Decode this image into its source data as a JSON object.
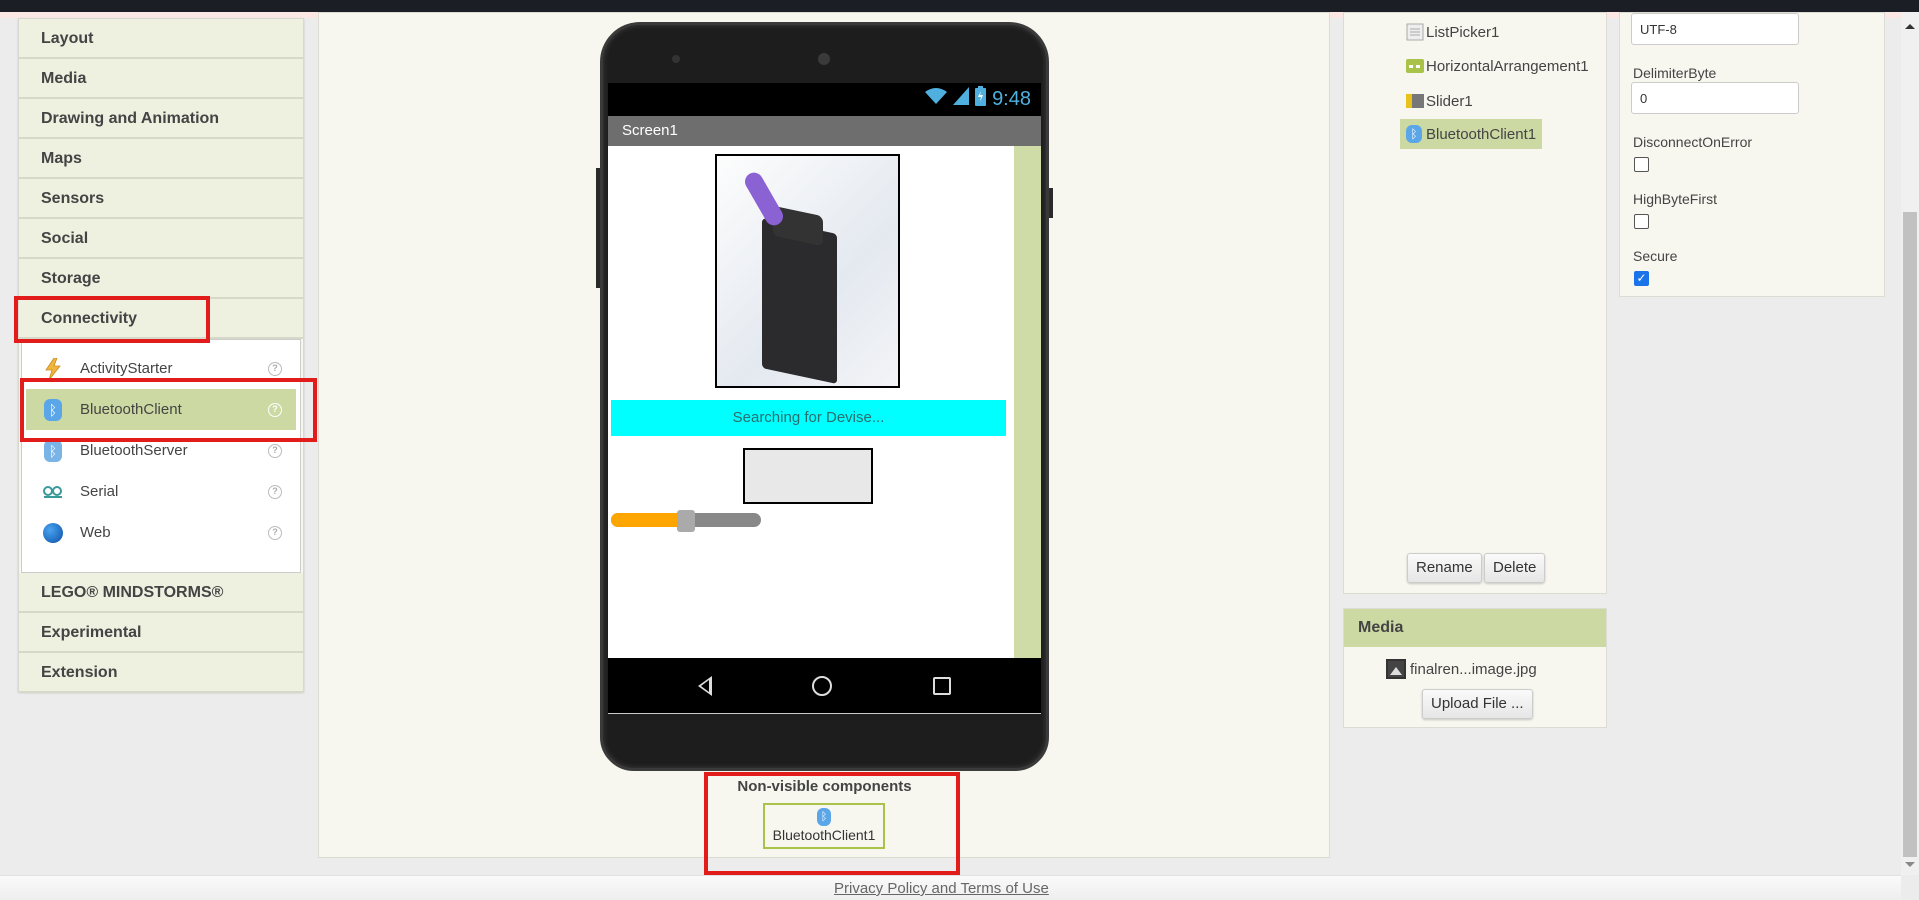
{
  "palette": {
    "categories_top": [
      "Layout",
      "Media",
      "Drawing and Animation",
      "Maps",
      "Sensors",
      "Social",
      "Storage",
      "Connectivity"
    ],
    "connectivity_items": [
      {
        "label": "ActivityStarter",
        "icon": "lightning-icon",
        "help": "?"
      },
      {
        "label": "BluetoothClient",
        "icon": "bluetooth-icon",
        "help": "?",
        "selected": true
      },
      {
        "label": "BluetoothServer",
        "icon": "bluetooth-icon",
        "help": "?"
      },
      {
        "label": "Serial",
        "icon": "serial-icon",
        "help": "?"
      },
      {
        "label": "Web",
        "icon": "globe-icon",
        "help": "?"
      }
    ],
    "categories_bottom": [
      "LEGO® MINDSTORMS®",
      "Experimental",
      "Extension"
    ]
  },
  "phone": {
    "status_time": "9:48",
    "screen_title": "Screen1",
    "label_text": "Searching for Devise...",
    "slider_value_fraction": 0.5
  },
  "nonvisible": {
    "title": "Non-visible components",
    "items": [
      "BluetoothClient1"
    ]
  },
  "components": {
    "items": [
      {
        "label": "ListPicker1",
        "icon": "listpicker-icon"
      },
      {
        "label": "HorizontalArrangement1",
        "icon": "horizontal-arrangement-icon"
      },
      {
        "label": "Slider1",
        "icon": "slider-icon"
      },
      {
        "label": "BluetoothClient1",
        "icon": "bluetooth-icon",
        "selected": true
      }
    ],
    "rename_label": "Rename",
    "delete_label": "Delete"
  },
  "media": {
    "title": "Media",
    "file": "finalren...image.jpg",
    "upload_label": "Upload File ..."
  },
  "properties": {
    "charset_value": "UTF-8",
    "delimiter_label": "DelimiterByte",
    "delimiter_value": "0",
    "disconnect_label": "DisconnectOnError",
    "disconnect_checked": false,
    "highbyte_label": "HighByteFirst",
    "highbyte_checked": false,
    "secure_label": "Secure",
    "secure_checked": true
  },
  "footer": {
    "link": "Privacy Policy and Terms of Use"
  },
  "colors": {
    "highlight_red": "#e21b1b",
    "selected_green": "#ccd9a3",
    "label_cyan": "#00ffff",
    "slider_orange": "#ffa500"
  }
}
